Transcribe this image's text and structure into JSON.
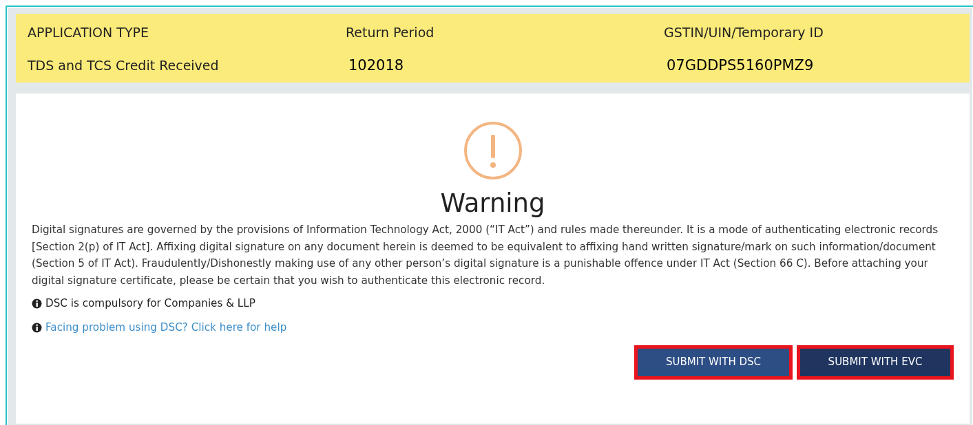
{
  "header": {
    "columns": [
      {
        "label": "APPLICATION TYPE",
        "value": "TDS and TCS Credit Received"
      },
      {
        "label": "Return Period",
        "value": "102018"
      },
      {
        "label": "GSTIN/UIN/Temporary ID",
        "value": "07GDDPS5160PMZ9"
      }
    ]
  },
  "warning": {
    "title": "Warning",
    "text": "Digital signatures are governed by the provisions of Information Technology Act, 2000 (“IT Act”) and rules made thereunder. It is a mode of authenticating electronic records [Section 2(p) of IT Act]. Affixing digital signature on any document herein is deemed to be equivalent to affixing hand written signature/mark on such information/document (Section 5 of IT Act). Fraudulently/Dishonestly making use of any other person’s digital signature is a punishable offence under IT Act (Section 66 C). Before attaching your digital signature certificate, please be certain that you wish to authenticate this electronic record.",
    "notes": [
      {
        "kind": "note",
        "text": "DSC is compulsory for Companies & LLP"
      },
      {
        "kind": "link",
        "text": "Facing problem using DSC? Click here for help"
      }
    ]
  },
  "buttons": [
    {
      "label": "SUBMIT WITH DSC",
      "highlighted": true,
      "kind": "light"
    },
    {
      "label": "SUBMIT WITH EVC",
      "highlighted": true,
      "kind": "dark"
    }
  ]
}
